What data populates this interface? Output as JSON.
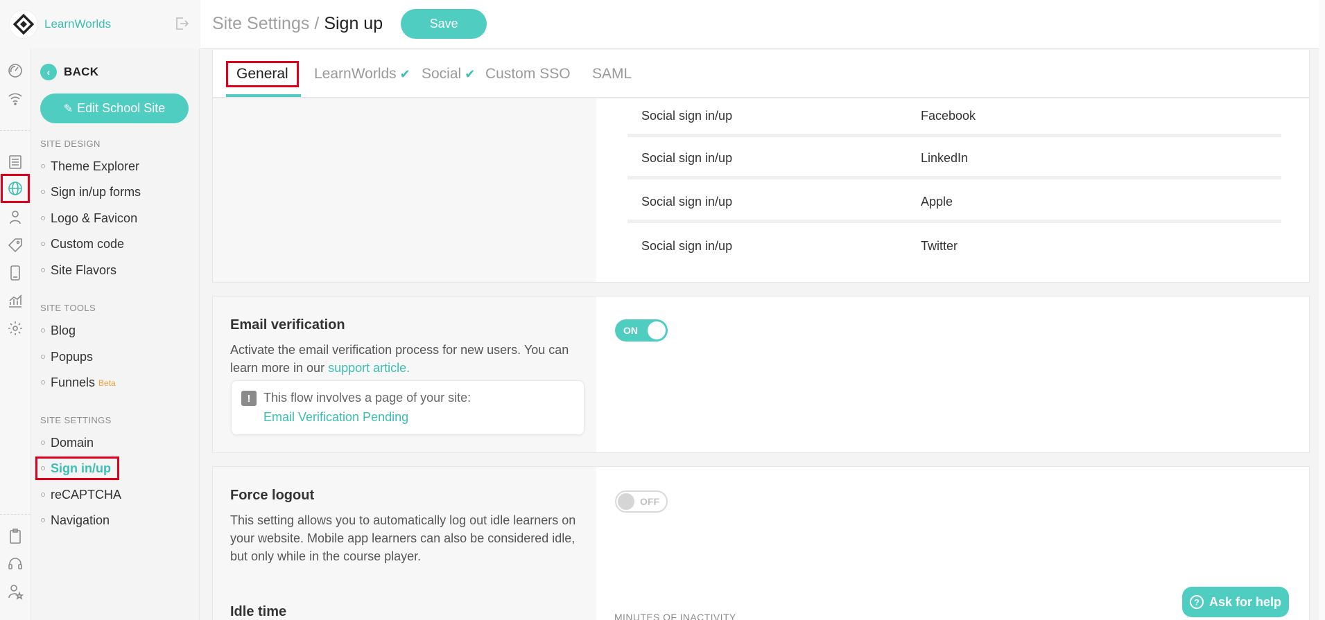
{
  "brand": {
    "name": "LearnWorlds"
  },
  "header": {
    "breadcrumb_parent": "Site Settings",
    "breadcrumb_separator": "/",
    "breadcrumb_current": "Sign up",
    "save_label": "Save"
  },
  "sidebar": {
    "back_label": "BACK",
    "edit_site_label": "Edit School Site",
    "sections": [
      {
        "title": "SITE DESIGN",
        "items": [
          "Theme Explorer",
          "Sign in/up forms",
          "Logo & Favicon",
          "Custom code",
          "Site Flavors"
        ]
      },
      {
        "title": "SITE TOOLS",
        "items": [
          "Blog",
          "Popups",
          "Funnels"
        ]
      },
      {
        "title": "SITE SETTINGS",
        "items": [
          "Domain",
          "Sign in/up",
          "reCAPTCHA",
          "Navigation"
        ]
      }
    ],
    "beta_badge": "Beta",
    "active_item": "Sign in/up"
  },
  "tabs": [
    {
      "label": "General",
      "active": true,
      "checked": false
    },
    {
      "label": "LearnWorlds",
      "active": false,
      "checked": true
    },
    {
      "label": "Social",
      "active": false,
      "checked": true
    },
    {
      "label": "Custom SSO",
      "active": false,
      "checked": false
    },
    {
      "label": "SAML",
      "active": false,
      "checked": false
    }
  ],
  "providers": [
    {
      "method": "Social sign in/up",
      "provider": "Facebook"
    },
    {
      "method": "Social sign in/up",
      "provider": "LinkedIn"
    },
    {
      "method": "Social sign in/up",
      "provider": "Apple"
    },
    {
      "method": "Social sign in/up",
      "provider": "Twitter"
    }
  ],
  "email_verification": {
    "title": "Email verification",
    "desc_prefix": "Activate the email verification process for new users. You can learn more in our",
    "desc_link": "support article.",
    "notice_text": "This flow involves a page of your site:",
    "notice_link": "Email Verification Pending",
    "toggle_label": "ON",
    "enabled": true
  },
  "force_logout": {
    "title": "Force logout",
    "desc": "This setting allows you to automatically log out idle learners on your website. Mobile app learners can also be considered idle, but only while in the course player.",
    "toggle_label": "OFF",
    "enabled": false
  },
  "idle_time": {
    "title": "Idle time",
    "minutes_label": "MINUTES OF INACTIVITY"
  },
  "help": {
    "label": "Ask for help"
  },
  "colors": {
    "accent": "#4ecdc0",
    "highlight_box": "#e0001b"
  }
}
